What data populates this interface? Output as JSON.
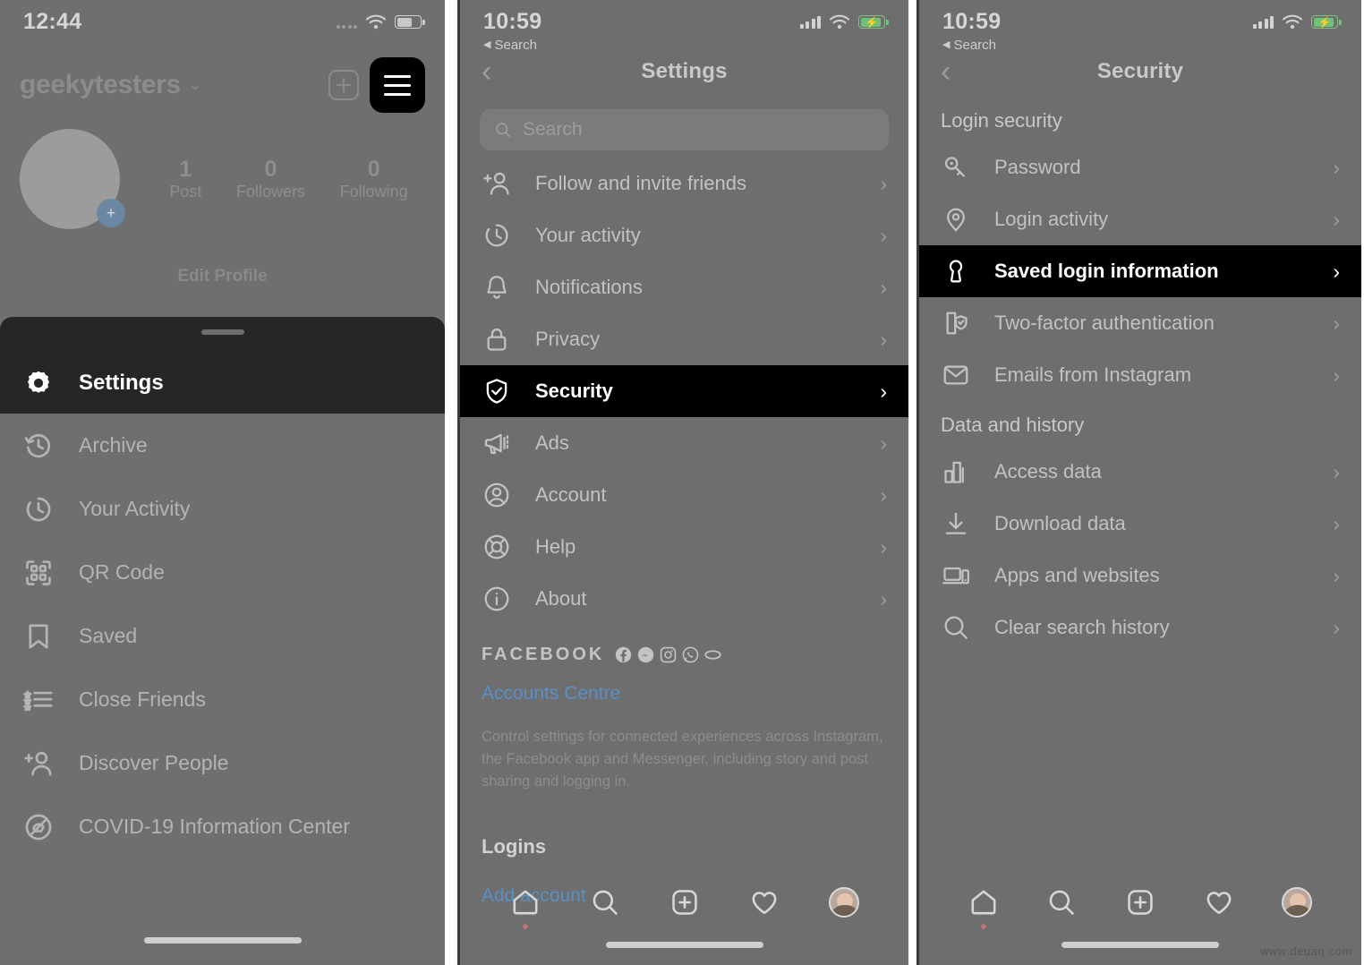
{
  "panel1": {
    "status": {
      "time": "12:44",
      "battery": "battery-low",
      "wifi": "wifi-icon"
    },
    "profile": {
      "username": "geekytesters",
      "stats": [
        {
          "num": "1",
          "label": "Post"
        },
        {
          "num": "0",
          "label": "Followers"
        },
        {
          "num": "0",
          "label": "Following"
        }
      ],
      "edit_profile": "Edit Profile",
      "add_photo_icon": "plus-icon",
      "new_post_icon": "new-post-icon",
      "menu_icon": "hamburger-menu-icon"
    },
    "sheet": {
      "highlight": {
        "label": "Settings",
        "icon": "gear-icon"
      },
      "items": [
        {
          "label": "Archive",
          "icon": "archive-clock-icon"
        },
        {
          "label": "Your Activity",
          "icon": "activity-clock-icon"
        },
        {
          "label": "QR Code",
          "icon": "qr-code-icon"
        },
        {
          "label": "Saved",
          "icon": "bookmark-icon"
        },
        {
          "label": "Close Friends",
          "icon": "close-friends-list-icon"
        },
        {
          "label": "Discover People",
          "icon": "add-person-icon"
        },
        {
          "label": "COVID-19 Information Center",
          "icon": "covid-info-icon"
        }
      ]
    }
  },
  "panel2": {
    "status": {
      "time": "10:59",
      "back_app": "Search",
      "battery": "battery-charging"
    },
    "nav": {
      "title": "Settings",
      "back_icon": "chevron-left-icon"
    },
    "search": {
      "placeholder": "Search",
      "icon": "search-icon"
    },
    "items": [
      {
        "label": "Follow and invite friends",
        "icon": "add-person-icon",
        "active": false
      },
      {
        "label": "Your activity",
        "icon": "activity-clock-icon",
        "active": false
      },
      {
        "label": "Notifications",
        "icon": "bell-icon",
        "active": false
      },
      {
        "label": "Privacy",
        "icon": "lock-icon",
        "active": false
      },
      {
        "label": "Security",
        "icon": "shield-check-icon",
        "active": true
      },
      {
        "label": "Ads",
        "icon": "megaphone-icon",
        "active": false
      },
      {
        "label": "Account",
        "icon": "account-circle-icon",
        "active": false
      },
      {
        "label": "Help",
        "icon": "help-lifebuoy-icon",
        "active": false
      },
      {
        "label": "About",
        "icon": "info-circle-icon",
        "active": false
      }
    ],
    "facebook": {
      "label": "FACEBOOK",
      "icons": [
        "facebook-icon",
        "messenger-icon",
        "instagram-icon",
        "whatsapp-icon",
        "oculus-icon"
      ],
      "accounts_centre": "Accounts Centre",
      "description": "Control settings for connected experiences across Instagram, the Facebook app and Messenger, including story and post sharing and logging in.",
      "logins_heading": "Logins",
      "add_account": "Add account"
    },
    "tabbar": [
      "home-icon",
      "search-icon",
      "new-post-icon",
      "heart-icon",
      "profile-avatar"
    ]
  },
  "panel3": {
    "status": {
      "time": "10:59",
      "back_app": "Search",
      "battery": "battery-charging"
    },
    "nav": {
      "title": "Security",
      "back_icon": "chevron-left-icon"
    },
    "sections": [
      {
        "heading": "Login security",
        "items": [
          {
            "label": "Password",
            "icon": "key-icon",
            "active": false
          },
          {
            "label": "Login activity",
            "icon": "location-pin-icon",
            "active": false
          },
          {
            "label": "Saved login information",
            "icon": "keyhole-icon",
            "active": true
          },
          {
            "label": "Two-factor authentication",
            "icon": "phone-shield-icon",
            "active": false
          },
          {
            "label": "Emails from Instagram",
            "icon": "mail-icon",
            "active": false
          }
        ]
      },
      {
        "heading": "Data and history",
        "items": [
          {
            "label": "Access data",
            "icon": "bar-chart-icon",
            "active": false
          },
          {
            "label": "Download data",
            "icon": "download-icon",
            "active": false
          },
          {
            "label": "Apps and websites",
            "icon": "apps-websites-icon",
            "active": false
          },
          {
            "label": "Clear search history",
            "icon": "search-icon",
            "active": false
          }
        ]
      }
    ],
    "tabbar": [
      "home-icon",
      "search-icon",
      "new-post-icon",
      "heart-icon",
      "profile-avatar"
    ]
  },
  "watermark": "www.deuaq.com",
  "colors": {
    "highlight": "#000000",
    "link": "#5a8fc7",
    "overlay": "#6e6e6e",
    "sheet": "#262626"
  }
}
